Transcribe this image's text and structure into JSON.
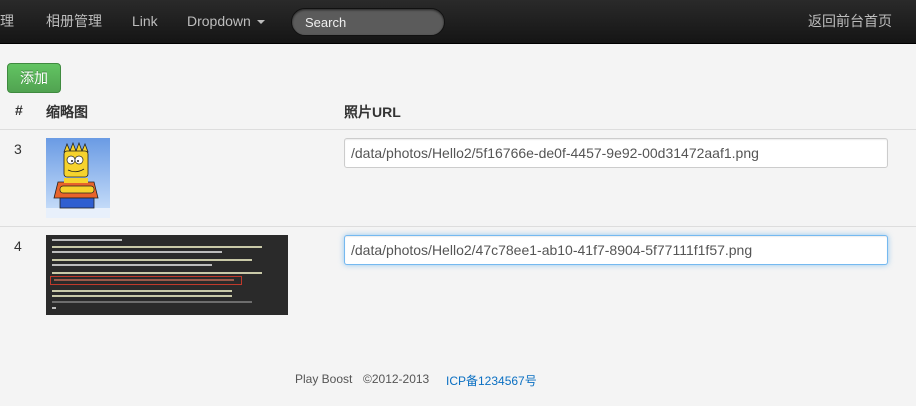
{
  "navbar": {
    "items": [
      {
        "label": "理"
      },
      {
        "label": "相册管理"
      },
      {
        "label": "Link"
      },
      {
        "label": "Dropdown"
      }
    ],
    "search_placeholder": "Search",
    "home_link": "返回前台首页"
  },
  "toolbar": {
    "add_label": "添加"
  },
  "table": {
    "headers": [
      "#",
      "缩略图",
      "照片URL"
    ],
    "rows": [
      {
        "id": "3",
        "url": "/data/photos/Hello2/5f16766e-de0f-4457-9e92-00d31472aaf1.png"
      },
      {
        "id": "4",
        "url": "/data/photos/Hello2/47c78ee1-ab10-41f7-8904-5f77111f1f57.png"
      }
    ]
  },
  "footer": {
    "brand": "Play Boost",
    "copyright": "©2012-2013",
    "icp": "ICP备1234567号"
  },
  "colors": {
    "navbar_bg": "#1b1b1b",
    "add_button": "#5bb75b",
    "link": "#0a6fc2",
    "focus_ring": "#52a8ec"
  }
}
